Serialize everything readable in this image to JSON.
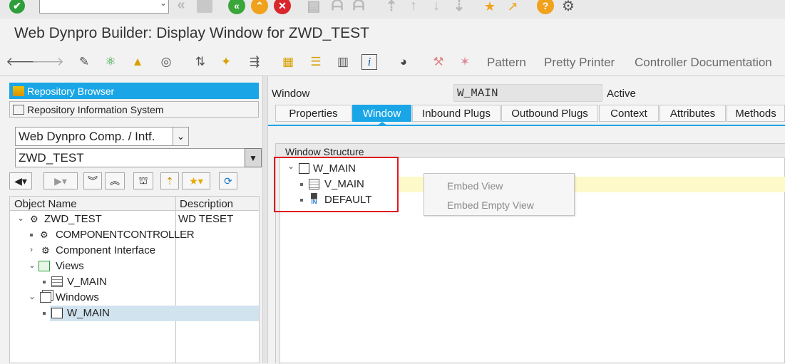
{
  "system_toolbar": {
    "command_field_value": "",
    "icons": [
      "check-icon",
      "back-icon",
      "save-icon",
      "back-green-icon",
      "exit-icon",
      "cancel-icon",
      "print-icon",
      "find-icon",
      "find-next-icon",
      "first-page-icon",
      "prev-page-icon",
      "next-page-icon",
      "last-page-icon",
      "create-session-icon",
      "shortcut-icon",
      "help-icon",
      "settings-icon"
    ]
  },
  "title": "Web Dynpro Builder: Display Window for ZWD_TEST",
  "app_toolbar": {
    "pattern_label": "Pattern",
    "pretty_printer_label": "Pretty Printer",
    "controller_doc_label": "Controller Documentation"
  },
  "left_pane": {
    "repository_browser": "Repository Browser",
    "repository_info": "Repository Information System",
    "object_type": "Web Dynpro Comp. / Intf.",
    "object_name": "ZWD_TEST",
    "tree": {
      "col_object": "Object Name",
      "col_desc": "Description",
      "rows": [
        {
          "label": "ZWD_TEST",
          "desc": "WD TESET"
        },
        {
          "label": "COMPONENTCONTROLLER",
          "desc": ""
        },
        {
          "label": "Component Interface",
          "desc": ""
        },
        {
          "label": "Views",
          "desc": ""
        },
        {
          "label": "V_MAIN",
          "desc": ""
        },
        {
          "label": "Windows",
          "desc": ""
        },
        {
          "label": "W_MAIN",
          "desc": ""
        }
      ]
    }
  },
  "right_pane": {
    "window_label": "Window",
    "window_value": "W_MAIN",
    "status": "Active",
    "tabs": [
      "Properties",
      "Window",
      "Inbound Plugs",
      "Outbound Plugs",
      "Context",
      "Attributes",
      "Methods"
    ],
    "active_tab": "Window",
    "structure_header": "Window Structure",
    "structure": {
      "root": "W_MAIN",
      "children": [
        "V_MAIN",
        "DEFAULT"
      ]
    },
    "context_menu": [
      "Embed View",
      "Embed Empty View"
    ]
  },
  "colors": {
    "accent": "#1aa6e6",
    "highlight": "#fdf9c8",
    "selection": "#d1e3ef",
    "annotation": "#e0191f"
  }
}
